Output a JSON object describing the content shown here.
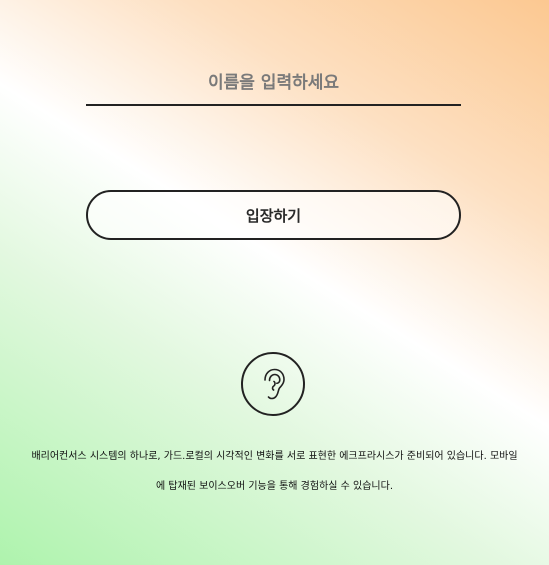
{
  "name_input": {
    "placeholder": "이름을 입력하세요",
    "value": ""
  },
  "enter_button": {
    "label": "입장하기"
  },
  "accessibility_button": {
    "icon": "ear-icon"
  },
  "description": {
    "text": "배리어컨서스 시스템의 하나로, 가드.로컬의 시각적인 변화를 서로 표현한 에크프라시스가 준비되어 있습니다. 모바일에 탑재된 보이스오버 기능을 통해 경험하실 수 있습니다."
  },
  "colors": {
    "gradient_orange": "#fcc891",
    "gradient_green": "#aef3ad",
    "line": "#222222"
  }
}
